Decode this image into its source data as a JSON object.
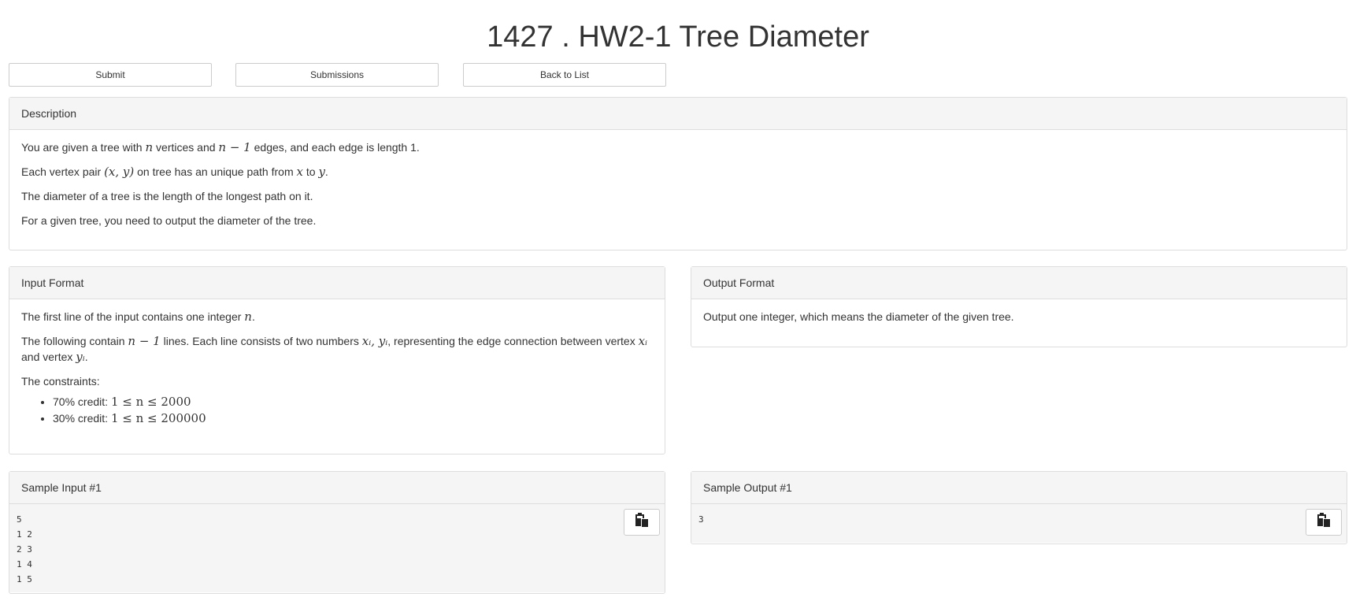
{
  "problem": {
    "title": "1427 . HW2-1 Tree Diameter"
  },
  "toolbar": {
    "submit_label": "Submit",
    "submissions_label": "Submissions",
    "back_label": "Back to List"
  },
  "description": {
    "heading": "Description",
    "line1_a": "You are given a tree with ",
    "line1_n": "n",
    "line1_b": " vertices and ",
    "line1_nm1": "n − 1",
    "line1_c": " edges, and each edge is length 1.",
    "line2_a": "Each vertex pair ",
    "line2_xy": "(x, y)",
    "line2_b": " on tree has an unique path from ",
    "line2_x": "x",
    "line2_c": " to ",
    "line2_y": "y",
    "line2_d": ".",
    "line3": "The diameter of a tree is the length of the longest path on it.",
    "line4": "For a given tree, you need to output the diameter of the tree."
  },
  "input_format": {
    "heading": "Input Format",
    "line1_a": "The first line of the input contains one integer ",
    "line1_n": "n",
    "line1_b": ".",
    "line2_a": "The following contain ",
    "line2_nm1": "n − 1",
    "line2_b": " lines. Each line consists of two numbers ",
    "line2_xiyi": "xᵢ, yᵢ",
    "line2_c": ", representing the edge connection between vertex ",
    "line2_xi": "xᵢ",
    "line2_d": " and vertex ",
    "line2_yi": "yᵢ",
    "line2_e": ".",
    "constraints_label": "The constraints:",
    "constraints": [
      {
        "credit": "70% credit: ",
        "expr": "1 ≤ n ≤ 2000"
      },
      {
        "credit": "30% credit: ",
        "expr": "1 ≤ n ≤ 200000"
      }
    ]
  },
  "output_format": {
    "heading": "Output Format",
    "text": "Output one integer, which means the diameter of the given tree."
  },
  "sample_input": {
    "heading": "Sample Input #1",
    "content": "5\n1 2\n2 3\n1 4\n1 5",
    "copy_icon": "clipboard-icon"
  },
  "sample_output": {
    "heading": "Sample Output #1",
    "content": "3",
    "copy_icon": "clipboard-icon"
  }
}
